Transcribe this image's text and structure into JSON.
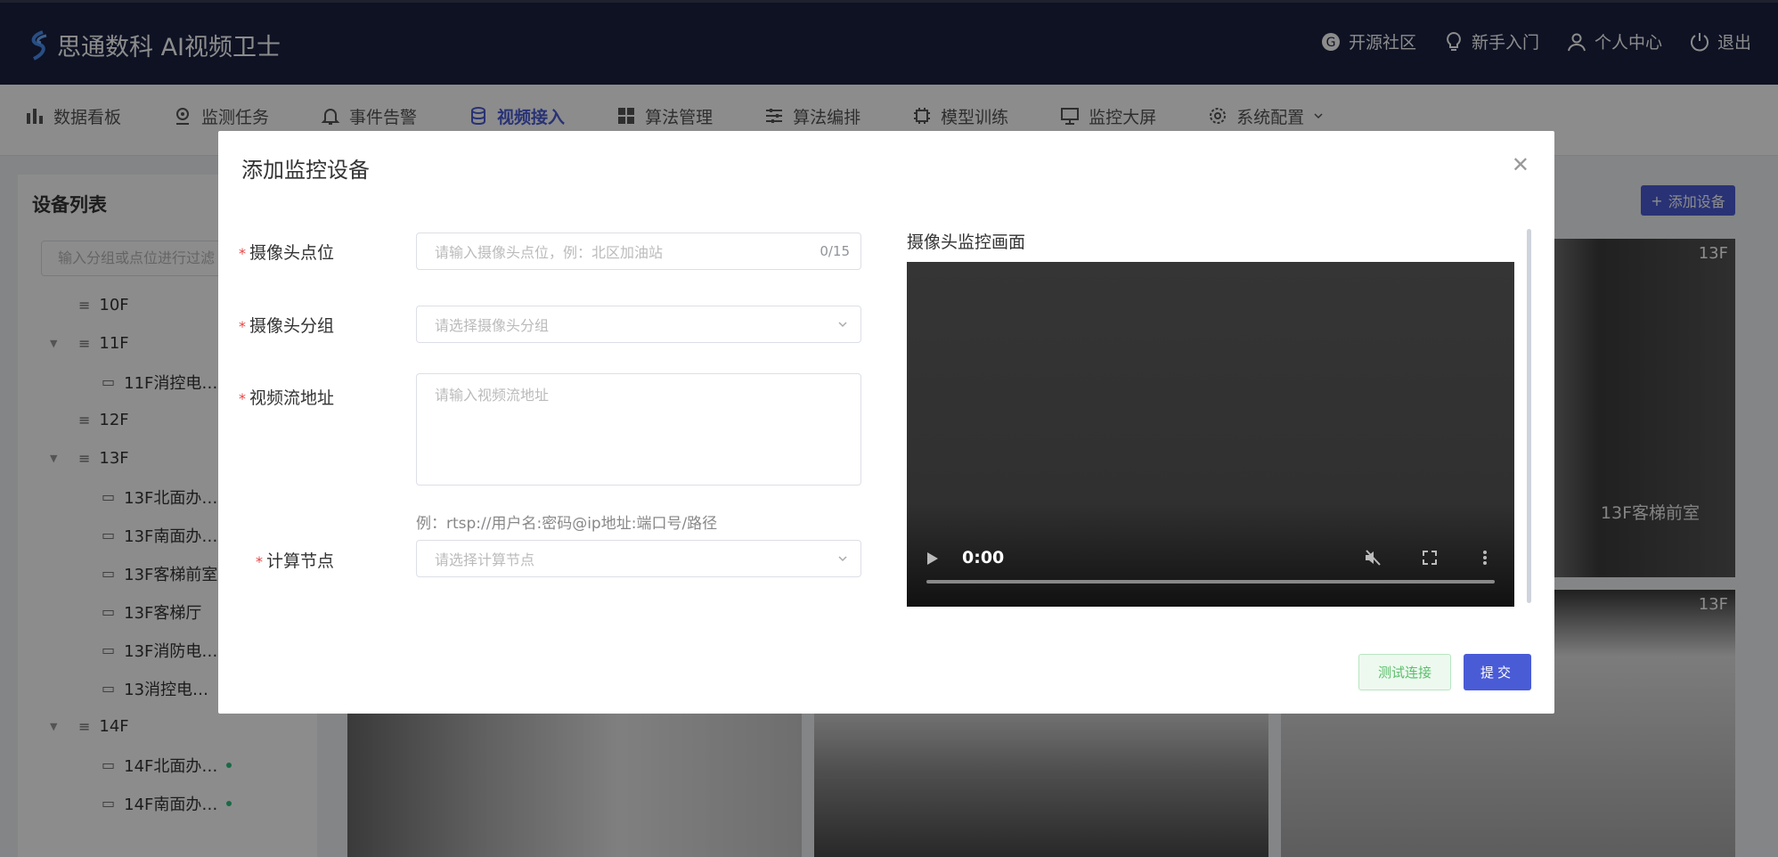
{
  "app": {
    "title": "思通数科 AI视频卫士",
    "links": [
      {
        "label": "开源社区",
        "icon": "community-icon"
      },
      {
        "label": "新手入门",
        "icon": "lightbulb-icon"
      },
      {
        "label": "个人中心",
        "icon": "user-icon"
      },
      {
        "label": "退出",
        "icon": "power-icon"
      }
    ]
  },
  "nav": {
    "items": [
      {
        "label": "数据看板",
        "icon": "bar-chart-icon"
      },
      {
        "label": "监测任务",
        "icon": "monitor-task-icon"
      },
      {
        "label": "事件告警",
        "icon": "bell-icon"
      },
      {
        "label": "视频接入",
        "icon": "database-icon",
        "active": true
      },
      {
        "label": "算法管理",
        "icon": "grid-icon"
      },
      {
        "label": "算法编排",
        "icon": "sliders-icon"
      },
      {
        "label": "模型训练",
        "icon": "chip-icon"
      },
      {
        "label": "监控大屏",
        "icon": "screen-icon"
      },
      {
        "label": "系统配置",
        "icon": "gear-icon"
      }
    ]
  },
  "device_panel": {
    "title": "设备列表",
    "search_placeholder": "输入分组或点位进行过滤",
    "tree": [
      {
        "label": "10F",
        "type": "group",
        "expanded": false
      },
      {
        "label": "11F",
        "type": "group",
        "expanded": true
      },
      {
        "label": "11F消控电…",
        "type": "camera"
      },
      {
        "label": "12F",
        "type": "group",
        "expanded": false
      },
      {
        "label": "13F",
        "type": "group",
        "expanded": true
      },
      {
        "label": "13F北面办…",
        "type": "camera"
      },
      {
        "label": "13F南面办…",
        "type": "camera"
      },
      {
        "label": "13F客梯前室",
        "type": "camera"
      },
      {
        "label": "13F客梯厅",
        "type": "camera"
      },
      {
        "label": "13F消防电…",
        "type": "camera"
      },
      {
        "label": "13消控电…",
        "type": "camera"
      },
      {
        "label": "14F",
        "type": "group",
        "expanded": true
      },
      {
        "label": "14F北面办…",
        "type": "camera",
        "online": true
      },
      {
        "label": "14F南面办…",
        "type": "camera",
        "online": true
      }
    ]
  },
  "main": {
    "add_device_label": "添加设备",
    "tiles": [
      {
        "floor": "13F",
        "caption": "13F客梯前室"
      },
      {
        "floor": "13F",
        "caption": ""
      }
    ]
  },
  "modal": {
    "title": "添加监控设备",
    "fields": {
      "point": {
        "label": "摄像头点位",
        "placeholder": "请输入摄像头点位，例：北区加油站",
        "count": "0/15"
      },
      "group": {
        "label": "摄像头分组",
        "placeholder": "请选择摄像头分组"
      },
      "stream": {
        "label": "视频流地址",
        "placeholder": "请输入视频流地址",
        "hint": "例：rtsp://用户名:密码@ip地址:端口号/路径"
      },
      "node": {
        "label": "计算节点",
        "placeholder": "请选择计算节点"
      }
    },
    "video": {
      "title": "摄像头监控画面",
      "time": "0:00"
    },
    "buttons": {
      "test": "测试连接",
      "submit": "提交"
    }
  }
}
